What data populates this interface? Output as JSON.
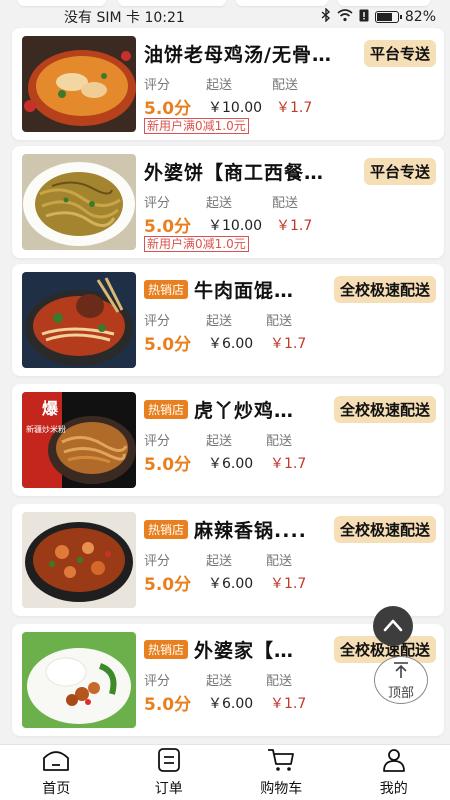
{
  "status_bar": {
    "carrier": "没有 SIM 卡",
    "time": "10:21",
    "battery": "82%",
    "battery_level": 0.82
  },
  "labels": {
    "score": "评分",
    "min_order": "起送",
    "delivery": "配送"
  },
  "shops": [
    {
      "name": "油饼老母鸡汤/无骨…",
      "tag": "平台专送",
      "hot": "",
      "score": "5.0分",
      "min_order": "￥10.00",
      "delivery_fee": "￥1.7",
      "promo": "新用户满0减1.0元",
      "image": "chicken-soup-image"
    },
    {
      "name": "外婆饼【商工西餐…",
      "tag": "平台专送",
      "hot": "",
      "score": "5.0分",
      "min_order": "￥10.00",
      "delivery_fee": "￥1.7",
      "promo": "新用户满0减1.0元",
      "image": "noodles-image"
    },
    {
      "name": "牛肉面馄…",
      "tag": "全校极速配送",
      "hot": "热销店",
      "score": "5.0分",
      "min_order": "￥6.00",
      "delivery_fee": "￥1.7",
      "promo": "",
      "image": "beef-noodle-image"
    },
    {
      "name": "虎丫炒鸡…",
      "tag": "全校极速配送",
      "hot": "热销店",
      "score": "5.0分",
      "min_order": "￥6.00",
      "delivery_fee": "￥1.7",
      "promo": "",
      "image": "fried-rice-noodle-image"
    },
    {
      "name": "麻辣香锅....",
      "tag": "全校极速配送",
      "hot": "热销店",
      "score": "5.0分",
      "min_order": "￥6.00",
      "delivery_fee": "￥1.7",
      "promo": "",
      "image": "spicy-pot-image"
    },
    {
      "name": "外婆家【…",
      "tag": "全校极速配送",
      "hot": "热销店",
      "score": "5.0分",
      "min_order": "￥6.00",
      "delivery_fee": "￥1.7",
      "promo": "",
      "image": "rice-dish-image"
    }
  ],
  "thumbnail_caption": "新疆炒米粉",
  "thumbnail_overlay": "爆",
  "float_buttons": {
    "up_icon": "chevron-up-icon",
    "back_to_top": "顶部"
  },
  "nav": {
    "home": "首页",
    "orders": "订单",
    "cart": "购物车",
    "mine": "我的"
  },
  "colors": {
    "accent": "#e8801f",
    "tag_bg": "#f6dfb7",
    "price_red": "#c0392b"
  }
}
